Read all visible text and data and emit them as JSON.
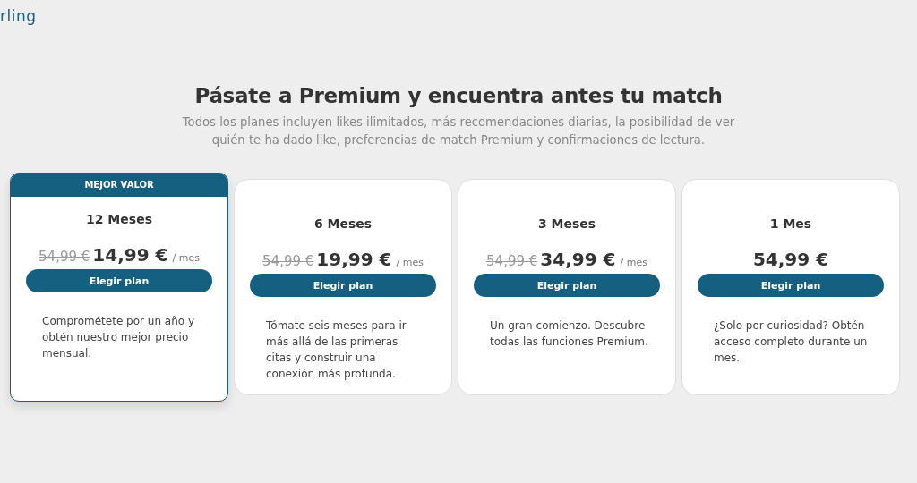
{
  "logo": "rling",
  "heading": "Pásate a Premium y encuentra antes tu match",
  "subheading": "Todos los planes incluyen likes ilimitados, más recomendaciones diarias, la posibilidad de ver quién te ha dado like, preferencias de match Premium y confirmaciones de lectura.",
  "plans": [
    {
      "badge": "MEJOR VALOR",
      "selected": true,
      "title": "12 Meses",
      "old_price": "54,99 €",
      "price": "14,99 €",
      "per": "/ mes",
      "button": "Elegir plan",
      "description": "Comprométete por un año y obtén nuestro mejor precio mensual."
    },
    {
      "selected": false,
      "title": "6 Meses",
      "old_price": "54,99 €",
      "price": "19,99 €",
      "per": "/ mes",
      "button": "Elegir plan",
      "description": "Tómate seis meses para ir más allá de las primeras citas y construir una conexión más profunda."
    },
    {
      "selected": false,
      "title": "3 Meses",
      "old_price": "54,99 €",
      "price": "34,99 €",
      "per": "/ mes",
      "button": "Elegir plan",
      "description": "Un gran comienzo. Descubre todas las funciones Premium."
    },
    {
      "selected": false,
      "title": "1 Mes",
      "price": "54,99 €",
      "button": "Elegir plan",
      "description": "¿Solo por curiosidad? Obtén acceso completo durante un mes."
    }
  ]
}
